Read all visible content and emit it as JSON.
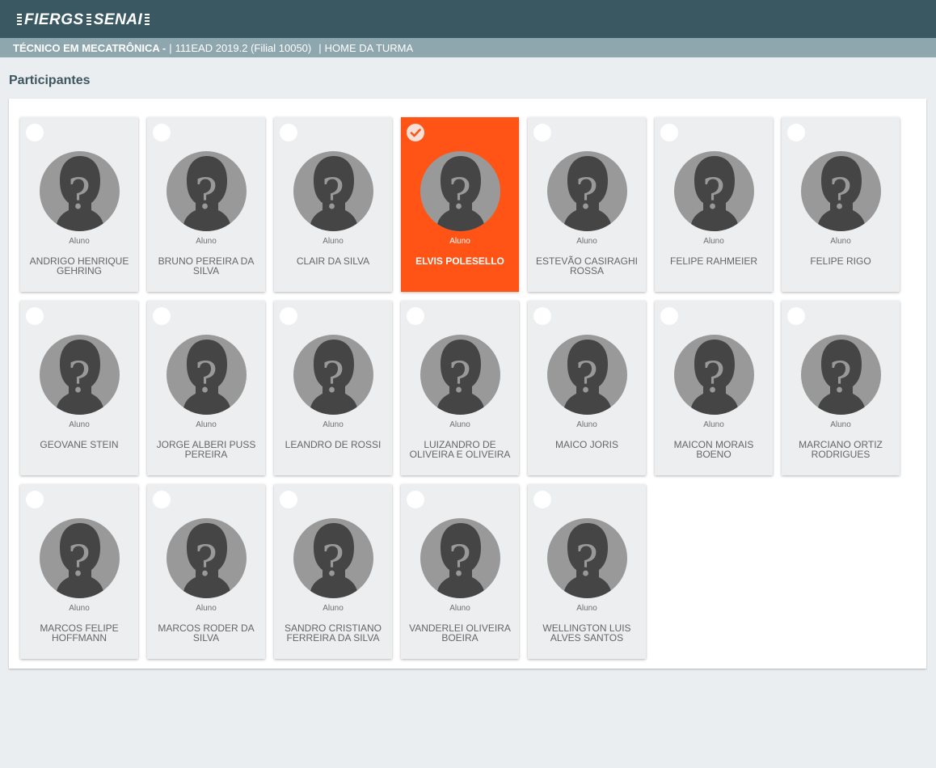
{
  "brand": {
    "logo_part1": "FIERGS",
    "logo_part2": "SENAI"
  },
  "header": {
    "course": "TÉCNICO EM MECATRÔNICA -",
    "class_info": "111EAD 2019.2 (Filial 10050)",
    "home_link": "HOME DA TURMA",
    "separator": "|"
  },
  "page": {
    "title": "Participantes"
  },
  "colors": {
    "header": "#3a5862",
    "subheader": "#8ea6ae",
    "selected": "#ff5416",
    "card": "#eceeef"
  },
  "participants": [
    {
      "role": "Aluno",
      "name": "ANDRIGO HENRIQUE GEHRING",
      "selected": false
    },
    {
      "role": "Aluno",
      "name": "BRUNO PEREIRA DA SILVA",
      "selected": false
    },
    {
      "role": "Aluno",
      "name": "CLAIR DA SILVA",
      "selected": false
    },
    {
      "role": "Aluno",
      "name": "ELVIS POLESELLO",
      "selected": true
    },
    {
      "role": "Aluno",
      "name": "ESTEVÃO CASIRAGHI ROSSA",
      "selected": false
    },
    {
      "role": "Aluno",
      "name": "FELIPE RAHMEIER",
      "selected": false
    },
    {
      "role": "Aluno",
      "name": "FELIPE RIGO",
      "selected": false
    },
    {
      "role": "Aluno",
      "name": "GEOVANE STEIN",
      "selected": false
    },
    {
      "role": "Aluno",
      "name": "JORGE ALBERI PUSS PEREIRA",
      "selected": false
    },
    {
      "role": "Aluno",
      "name": "LEANDRO DE ROSSI",
      "selected": false
    },
    {
      "role": "Aluno",
      "name": "LUIZANDRO DE OLIVEIRA E OLIVEIRA",
      "selected": false
    },
    {
      "role": "Aluno",
      "name": "MAICO JORIS",
      "selected": false
    },
    {
      "role": "Aluno",
      "name": "MAICON MORAIS BOENO",
      "selected": false
    },
    {
      "role": "Aluno",
      "name": "MARCIANO ORTIZ RODRIGUES",
      "selected": false
    },
    {
      "role": "Aluno",
      "name": "MARCOS FELIPE HOFFMANN",
      "selected": false
    },
    {
      "role": "Aluno",
      "name": "MARCOS RODER DA SILVA",
      "selected": false
    },
    {
      "role": "Aluno",
      "name": "SANDRO CRISTIANO FERREIRA DA SILVA",
      "selected": false
    },
    {
      "role": "Aluno",
      "name": "VANDERLEI OLIVEIRA BOEIRA",
      "selected": false
    },
    {
      "role": "Aluno",
      "name": "WELLINGTON LUIS ALVES SANTOS",
      "selected": false
    }
  ]
}
